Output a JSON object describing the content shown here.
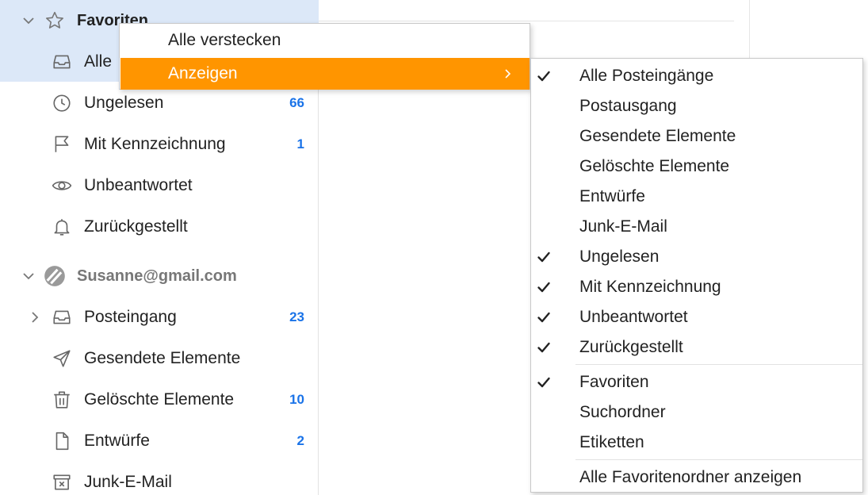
{
  "sidebar": {
    "favorites": {
      "label": "Favoriten",
      "items": [
        {
          "label": "Alle",
          "count": ""
        },
        {
          "label": "Ungelesen",
          "count": "66"
        },
        {
          "label": "Mit Kennzeichnung",
          "count": "1"
        },
        {
          "label": "Unbeantwortet",
          "count": ""
        },
        {
          "label": "Zurückgestellt",
          "count": ""
        }
      ]
    },
    "account": {
      "label": "Susanne@gmail.com",
      "items": [
        {
          "label": "Posteingang",
          "count": "23"
        },
        {
          "label": "Gesendete Elemente",
          "count": ""
        },
        {
          "label": "Gelöschte Elemente",
          "count": "10"
        },
        {
          "label": "Entwürfe",
          "count": "2"
        },
        {
          "label": "Junk-E-Mail",
          "count": ""
        }
      ]
    }
  },
  "context_menu": {
    "hide_all": "Alle verstecken",
    "show": "Anzeigen"
  },
  "submenu": {
    "items": [
      {
        "label": "Alle Posteingänge",
        "checked": true
      },
      {
        "label": "Postausgang",
        "checked": false
      },
      {
        "label": "Gesendete Elemente",
        "checked": false
      },
      {
        "label": "Gelöschte Elemente",
        "checked": false
      },
      {
        "label": "Entwürfe",
        "checked": false
      },
      {
        "label": "Junk-E-Mail",
        "checked": false
      },
      {
        "label": "Ungelesen",
        "checked": true
      },
      {
        "label": "Mit Kennzeichnung",
        "checked": true
      },
      {
        "label": "Unbeantwortet",
        "checked": true
      },
      {
        "label": "Zurückgestellt",
        "checked": true
      },
      {
        "label": "Favoriten",
        "checked": true
      },
      {
        "label": "Suchordner",
        "checked": false
      },
      {
        "label": "Etiketten",
        "checked": false
      },
      {
        "label": "Alle Favoritenordner anzeigen",
        "checked": false
      }
    ]
  },
  "colors": {
    "accent": "#ff9500",
    "count": "#1a73e8",
    "selection": "#dce8f8"
  }
}
